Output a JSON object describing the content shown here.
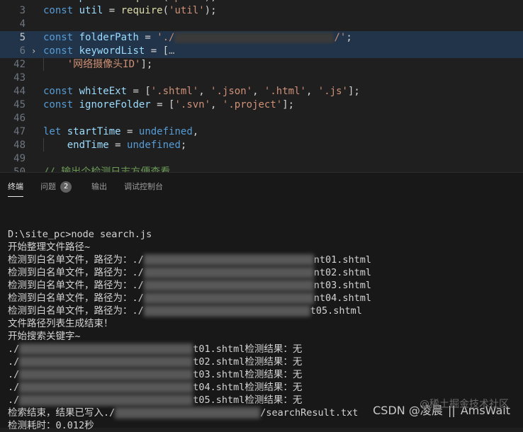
{
  "editor": {
    "lines": [
      {
        "num": "3",
        "tokens": [
          {
            "t": "kw",
            "v": "const"
          },
          {
            "t": "pun",
            "v": " "
          },
          {
            "t": "var",
            "v": "util"
          },
          {
            "t": "pun",
            "v": " = "
          },
          {
            "t": "fn",
            "v": "require"
          },
          {
            "t": "pun",
            "v": "("
          },
          {
            "t": "str",
            "v": "'util'"
          },
          {
            "t": "pun",
            "v": ");"
          }
        ]
      },
      {
        "num": "4",
        "tokens": []
      },
      {
        "num": "5",
        "tokens": [
          {
            "t": "kw",
            "v": "const"
          },
          {
            "t": "pun",
            "v": " "
          },
          {
            "t": "var",
            "v": "folderPath"
          },
          {
            "t": "pun",
            "v": " = "
          },
          {
            "t": "str",
            "v": "'./"
          },
          {
            "t": "blur",
            "v": ""
          },
          {
            "t": "str",
            "v": "/'"
          },
          {
            "t": "pun",
            "v": ";"
          }
        ]
      },
      {
        "num": "6",
        "tokens": [
          {
            "t": "kw",
            "v": "const"
          },
          {
            "t": "pun",
            "v": " "
          },
          {
            "t": "var",
            "v": "keywordList"
          },
          {
            "t": "pun",
            "v": " = "
          },
          {
            "t": "pun",
            "v": "["
          },
          {
            "t": "fold",
            "v": "…"
          }
        ]
      },
      {
        "num": "42",
        "tokens": [
          {
            "t": "pun",
            "v": "    "
          },
          {
            "t": "str",
            "v": "'网络摄像头ID'"
          },
          {
            "t": "pun",
            "v": "];"
          }
        ]
      },
      {
        "num": "43",
        "tokens": []
      },
      {
        "num": "44",
        "tokens": [
          {
            "t": "kw",
            "v": "const"
          },
          {
            "t": "pun",
            "v": " "
          },
          {
            "t": "var",
            "v": "whiteExt"
          },
          {
            "t": "pun",
            "v": " = ["
          },
          {
            "t": "str",
            "v": "'.shtml'"
          },
          {
            "t": "pun",
            "v": ", "
          },
          {
            "t": "str",
            "v": "'.json'"
          },
          {
            "t": "pun",
            "v": ", "
          },
          {
            "t": "str",
            "v": "'.html'"
          },
          {
            "t": "pun",
            "v": ", "
          },
          {
            "t": "str",
            "v": "'.js'"
          },
          {
            "t": "pun",
            "v": "];"
          }
        ]
      },
      {
        "num": "45",
        "tokens": [
          {
            "t": "kw",
            "v": "const"
          },
          {
            "t": "pun",
            "v": " "
          },
          {
            "t": "var",
            "v": "ignoreFolder"
          },
          {
            "t": "pun",
            "v": " = ["
          },
          {
            "t": "str",
            "v": "'.svn'"
          },
          {
            "t": "pun",
            "v": ", "
          },
          {
            "t": "str",
            "v": "'.project'"
          },
          {
            "t": "pun",
            "v": "];"
          }
        ]
      },
      {
        "num": "46",
        "tokens": []
      },
      {
        "num": "47",
        "tokens": [
          {
            "t": "kw",
            "v": "let"
          },
          {
            "t": "pun",
            "v": " "
          },
          {
            "t": "var",
            "v": "startTime"
          },
          {
            "t": "pun",
            "v": " = "
          },
          {
            "t": "kw",
            "v": "undefined"
          },
          {
            "t": "pun",
            "v": ","
          }
        ]
      },
      {
        "num": "48",
        "tokens": [
          {
            "t": "pun",
            "v": "    "
          },
          {
            "t": "var",
            "v": "endTime"
          },
          {
            "t": "pun",
            "v": " = "
          },
          {
            "t": "kw",
            "v": "undefined"
          },
          {
            "t": "pun",
            "v": ";"
          }
        ]
      },
      {
        "num": "49",
        "tokens": []
      },
      {
        "num": "50",
        "tokens": [
          {
            "t": "cmt",
            "v": "// 输出个检测日志方便查看"
          }
        ]
      }
    ]
  },
  "panel": {
    "tabs": [
      {
        "label": "终端",
        "active": true
      },
      {
        "label": "问题",
        "badge": "2"
      },
      {
        "label": "输出"
      },
      {
        "label": "调试控制台"
      }
    ]
  },
  "terminal": {
    "lines": [
      [
        {
          "t": "text",
          "v": ""
        }
      ],
      [
        {
          "t": "text",
          "v": "D:\\site_pc>node search.js"
        }
      ],
      [
        {
          "t": "text",
          "v": "开始整理文件路径~"
        }
      ],
      [
        {
          "t": "text",
          "v": "检测到白名单文件，路径为：./"
        },
        {
          "t": "blur",
          "v": ""
        },
        {
          "t": "text",
          "v": "nt01.shtml"
        }
      ],
      [
        {
          "t": "text",
          "v": "检测到白名单文件，路径为：./"
        },
        {
          "t": "blur",
          "v": ""
        },
        {
          "t": "text",
          "v": "nt02.shtml"
        }
      ],
      [
        {
          "t": "text",
          "v": "检测到白名单文件，路径为：./"
        },
        {
          "t": "blur",
          "v": ""
        },
        {
          "t": "text",
          "v": "nt03.shtml"
        }
      ],
      [
        {
          "t": "text",
          "v": "检测到白名单文件，路径为：./"
        },
        {
          "t": "blur",
          "v": ""
        },
        {
          "t": "text",
          "v": "nt04.shtml"
        }
      ],
      [
        {
          "t": "text",
          "v": "检测到白名单文件，路径为：./"
        },
        {
          "t": "blur",
          "v": ""
        },
        {
          "t": "text",
          "v": "t05.shtml"
        }
      ],
      [
        {
          "t": "text",
          "v": "文件路径列表生成结束！"
        }
      ],
      [
        {
          "t": "text",
          "v": "开始搜索关键字~"
        }
      ],
      [
        {
          "t": "text",
          "v": "./"
        },
        {
          "t": "blur",
          "v": ""
        },
        {
          "t": "text",
          "v": "t01.shtml检测结果：无"
        }
      ],
      [
        {
          "t": "text",
          "v": "./"
        },
        {
          "t": "blur",
          "v": ""
        },
        {
          "t": "text",
          "v": "t02.shtml检测结果：无"
        }
      ],
      [
        {
          "t": "text",
          "v": "./"
        },
        {
          "t": "blur",
          "v": ""
        },
        {
          "t": "text",
          "v": "t03.shtml检测结果：无"
        }
      ],
      [
        {
          "t": "text",
          "v": "./"
        },
        {
          "t": "blur",
          "v": ""
        },
        {
          "t": "text",
          "v": "t04.shtml检测结果：无"
        }
      ],
      [
        {
          "t": "text",
          "v": "./"
        },
        {
          "t": "blur",
          "v": ""
        },
        {
          "t": "text",
          "v": "t05.shtml检测结果：无"
        }
      ],
      [
        {
          "t": "text",
          "v": "检索结束，结果已写入./"
        },
        {
          "t": "blur",
          "v": ""
        },
        {
          "t": "text",
          "v": "/searchResult.txt"
        }
      ],
      [
        {
          "t": "text",
          "v": "检测耗时：0.012秒"
        }
      ]
    ]
  },
  "watermark": {
    "csdn": "CSDN @凌晨",
    "sep": "||",
    "name": "AmsWait",
    "faint": "@稀土掘金技术社区"
  }
}
